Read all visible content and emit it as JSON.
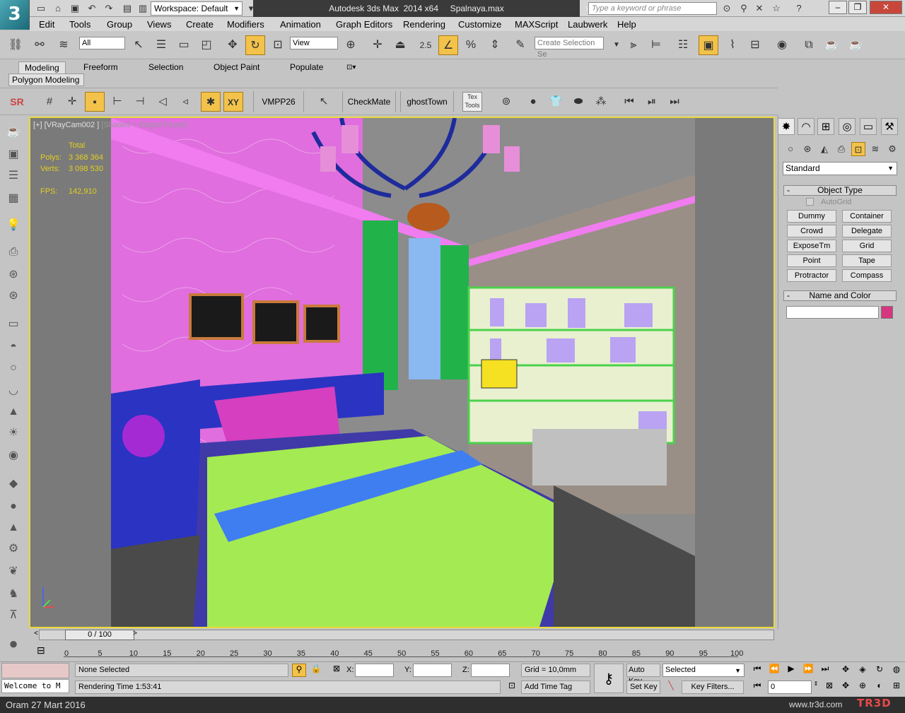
{
  "titlebar": {
    "workspace_label": "Workspace: Default",
    "app_title": "Autodesk 3ds Max  2014 x64     Spalnaya.max",
    "search_placeholder": "Type a keyword or phrase"
  },
  "menu": [
    "Edit",
    "Tools",
    "Group",
    "Views",
    "Create",
    "Modifiers",
    "Animation",
    "Graph Editors",
    "Rendering",
    "Customize",
    "MAXScript",
    "Laubwerk",
    "Help"
  ],
  "toolbar": {
    "filter_value": "All",
    "view_value": "View",
    "snap_value": "2.5",
    "selection_set_placeholder": "Create Selection Se"
  },
  "ribbon": {
    "tabs": [
      "Modeling",
      "Freeform",
      "Selection",
      "Object Paint",
      "Populate"
    ],
    "subtab": "Polygon Modeling"
  },
  "toolbar2": {
    "sr_label": "SR",
    "xy_label": "XY",
    "plugins": [
      "VMPP26",
      "CheckMate",
      "ghostTown"
    ],
    "tex_tools": "Tex Tools"
  },
  "viewport": {
    "label_prefix": "[+] [VRayCam002 ]",
    "label_mode": "[Shaded + Edged Faces]",
    "stats": {
      "total_label": "Total",
      "polys_label": "Polys:",
      "polys_value": "3 368 364",
      "verts_label": "Verts:",
      "verts_value": "3 098 530",
      "fps_label": "FPS:",
      "fps_value": "142,910"
    }
  },
  "command_panel": {
    "category": "Standard",
    "object_type_title": "Object Type",
    "autogrid_label": "AutoGrid",
    "object_buttons": [
      "Dummy",
      "Container",
      "Crowd",
      "Delegate",
      "ExposeTm",
      "Grid",
      "Point",
      "Tape",
      "Protractor",
      "Compass"
    ],
    "name_color_title": "Name and Color",
    "name_value": "",
    "swatch_color": "#d6367f"
  },
  "timeline": {
    "frame_label": "0 / 100",
    "ticks": [
      "0",
      "5",
      "10",
      "15",
      "20",
      "25",
      "30",
      "35",
      "40",
      "45",
      "50",
      "55",
      "60",
      "65",
      "70",
      "75",
      "80",
      "85",
      "90",
      "95",
      "100"
    ]
  },
  "status": {
    "selection_text": "None Selected",
    "render_time": "Rendering Time  1:53:41",
    "maxscript_text": "Welcome to M",
    "x_label": "X:",
    "y_label": "Y:",
    "z_label": "Z:",
    "grid_text": "Grid = 10,0mm",
    "add_time_tag": "Add Time Tag",
    "auto_key": "Auto Key",
    "set_key": "Set Key",
    "key_mode_value": "Selected",
    "key_filters": "Key Filters...",
    "frame_value": "0"
  },
  "bottombar": {
    "date_text": "Oram 27 Mart 2016",
    "site_text": "www.tr3d.com",
    "logo_text": "TR3D"
  }
}
